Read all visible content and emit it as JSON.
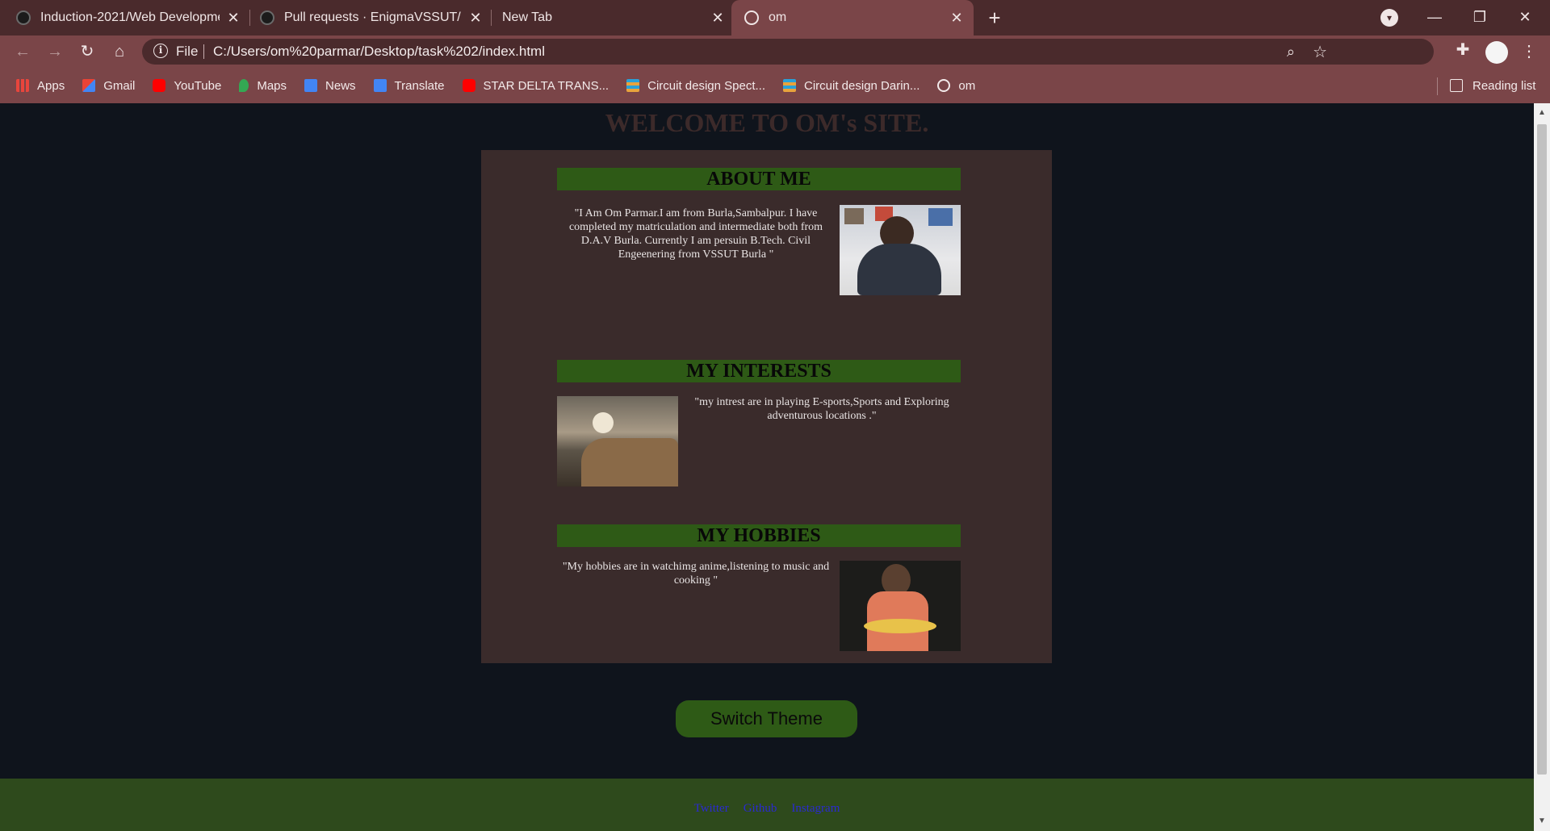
{
  "browser": {
    "tabs": [
      {
        "title": "Induction-2021/Web Developme",
        "icon": "github-icon"
      },
      {
        "title": "Pull requests · EnigmaVSSUT/Ind",
        "icon": "github-icon"
      },
      {
        "title": "New Tab",
        "icon": ""
      },
      {
        "title": "om",
        "icon": "globe-icon",
        "active": true
      }
    ],
    "address": {
      "scheme_label": "File",
      "url": "C:/Users/om%20parmar/Desktop/task%202/index.html"
    },
    "bookmarks": [
      {
        "label": "Apps",
        "icon": "apps-grid-icon",
        "color": "#e8453c"
      },
      {
        "label": "Gmail",
        "icon": "gmail-icon",
        "color": "#ea4335"
      },
      {
        "label": "YouTube",
        "icon": "youtube-icon",
        "color": "#ff0000"
      },
      {
        "label": "Maps",
        "icon": "maps-icon",
        "color": "#34a853"
      },
      {
        "label": "News",
        "icon": "news-icon",
        "color": "#4285f4"
      },
      {
        "label": "Translate",
        "icon": "translate-icon",
        "color": "#4285f4"
      },
      {
        "label": "STAR DELTA TRANS...",
        "icon": "youtube-icon",
        "color": "#ff0000"
      },
      {
        "label": "Circuit design Spect...",
        "icon": "tinkercad-icon",
        "color": "#e8a33c"
      },
      {
        "label": "Circuit design Darin...",
        "icon": "tinkercad-icon",
        "color": "#e8a33c"
      },
      {
        "label": "om",
        "icon": "globe-icon",
        "color": "#f3eaea"
      }
    ],
    "reading_list_label": "Reading list"
  },
  "page": {
    "welcome": "WELCOME TO OM's SITE.",
    "sections": [
      {
        "heading": "ABOUT ME",
        "text": "\"I Am Om Parmar.I am from Burla,Sambalpur. I have completed my matriculation and intermediate both from D.A.V Burla. Currently I am persuin B.Tech. Civil Engeenering from VSSUT Burla \""
      },
      {
        "heading": "MY INTERESTS",
        "text": "\"my intrest are in playing E-sports,Sports and Exploring adventurous locations .\""
      },
      {
        "heading": "MY HOBBIES",
        "text": "\"My hobbies are in watchimg anime,listening to music and cooking \""
      }
    ],
    "switch_theme_label": "Switch Theme",
    "footer_links": [
      "Twitter",
      "Github",
      "Instagram"
    ]
  },
  "colors": {
    "tabstrip": "#4a2a2c",
    "toolbar": "#7a4548",
    "page_bg": "#0f141c",
    "card_bg": "#3a2b2b",
    "accent_green": "#2e5a16",
    "footer_bg": "#2e4a1c",
    "link_blue": "#2a2ad0"
  }
}
